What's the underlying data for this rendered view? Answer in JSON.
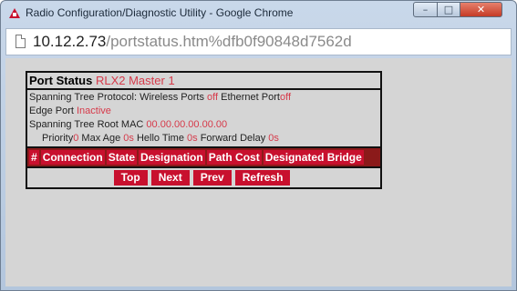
{
  "window": {
    "title": "Radio Configuration/Diagnostic Utility - Google Chrome",
    "minimize_glyph": "–",
    "maximize_glyph": "□",
    "close_glyph": "✕"
  },
  "address": {
    "host": "10.12.2.73",
    "path": "/portstatus.htm%dfb0f90848d7562d"
  },
  "port_status": {
    "heading": "Port Status",
    "device": "RLX2 Master 1",
    "stp_label": "Spanning Tree Protocol: Wireless Ports",
    "wireless_ports_value": "off",
    "ethernet_port_label": "Ethernet Port",
    "ethernet_port_value": "off",
    "edge_port_label": "Edge Port",
    "edge_port_value": "Inactive",
    "root_mac_label": "Spanning Tree Root MAC",
    "root_mac_value": "00.00.00.00.00.00",
    "priority_label": "Priority",
    "priority_value": "0",
    "max_age_label": "Max Age",
    "max_age_value": "0s",
    "hello_time_label": "Hello Time",
    "hello_time_value": "0s",
    "forward_delay_label": "Forward Delay",
    "forward_delay_value": "0s"
  },
  "table": {
    "columns": [
      "#",
      "Connection",
      "State",
      "Designation",
      "Path Cost",
      "Designated Bridge"
    ]
  },
  "nav": {
    "top": "Top",
    "next": "Next",
    "prev": "Prev",
    "refresh": "Refresh"
  },
  "colors": {
    "accent_red": "#c8102e",
    "value_red": "#d63a4a"
  }
}
